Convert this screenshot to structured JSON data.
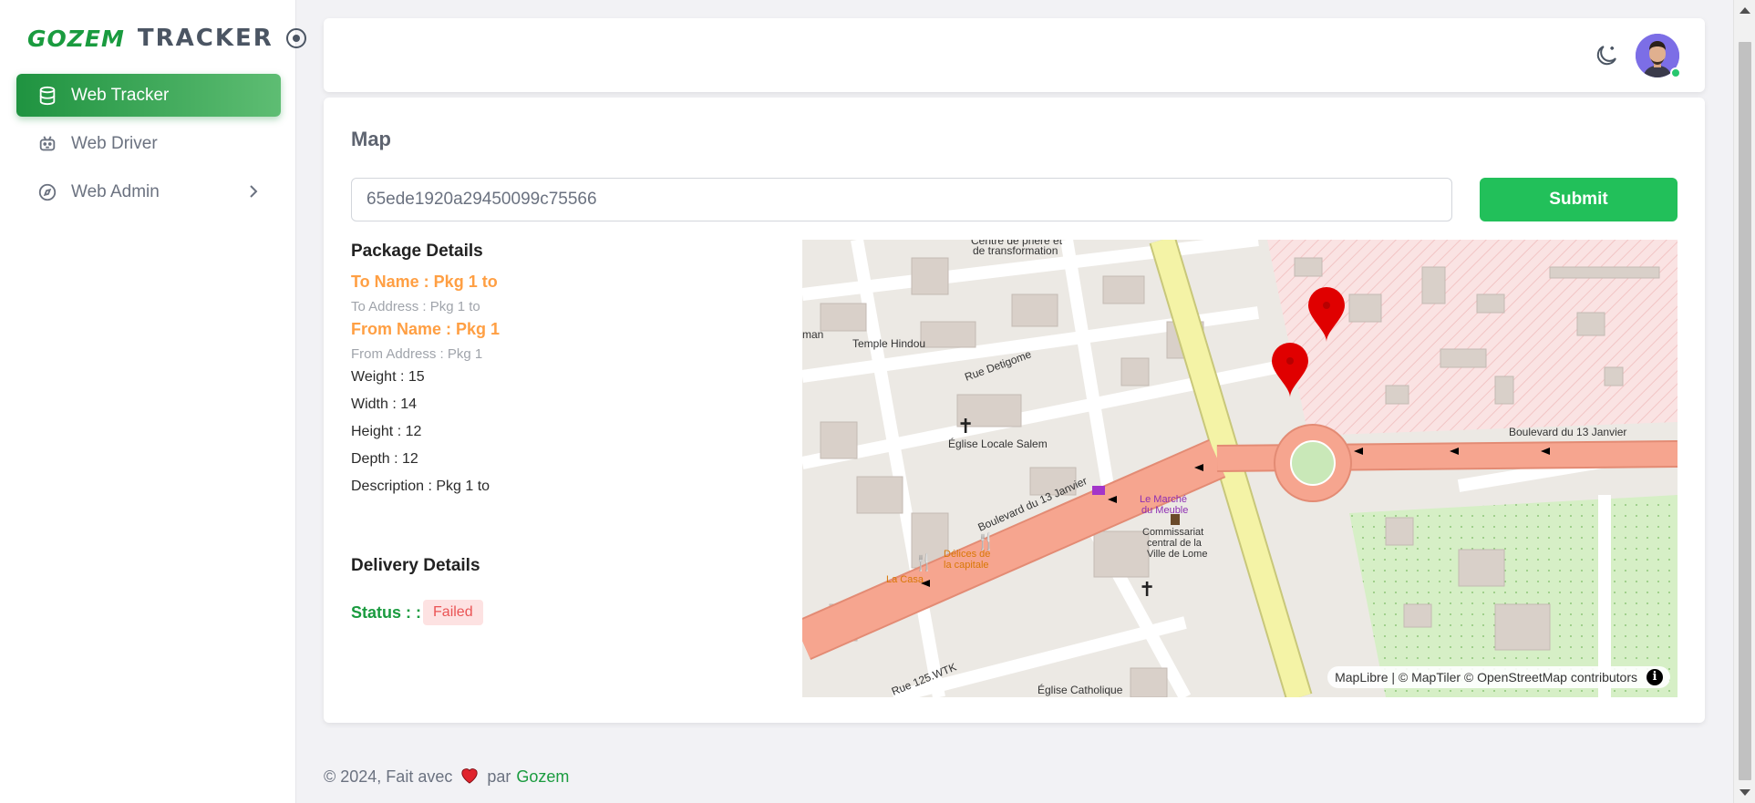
{
  "brand": {
    "name": "GOZEM",
    "product": "TRACKER"
  },
  "sidebar": {
    "items": [
      {
        "label": "Web Tracker",
        "icon": "database-icon",
        "active": true
      },
      {
        "label": "Web Driver",
        "icon": "robot-icon",
        "active": false
      },
      {
        "label": "Web Admin",
        "icon": "compass-icon",
        "active": false,
        "has_submenu": true
      }
    ]
  },
  "header": {
    "theme_icon": "moon-icon",
    "avatar": "user-avatar",
    "status": "online"
  },
  "main": {
    "title": "Map",
    "search": {
      "value": "65ede1920a29450099c75566"
    },
    "submit_label": "Submit"
  },
  "package": {
    "title": "Package Details",
    "to_name": "To Name : Pkg 1 to",
    "to_address": "To Address : Pkg 1 to",
    "from_name": "From Name : Pkg 1",
    "from_address": "From Address : Pkg 1",
    "weight": "Weight : 15",
    "width": "Width : 14",
    "height": "Height : 12",
    "depth": "Depth : 12",
    "description": "Description : Pkg 1 to"
  },
  "delivery": {
    "title": "Delivery Details",
    "status_label": "Status : :",
    "status_value": "Failed"
  },
  "map": {
    "labels": {
      "temple": "Temple Hindou",
      "rue": "Rue Detigome",
      "eglise_salem": "Église Locale Salem",
      "boulevard_left": "Boulevard du 13 Janvier",
      "boulevard_right": "Boulevard du 13 Janvier",
      "marche_1": "Le Marché",
      "marche_2": "du Meuble",
      "commissariat_1": "Commissariat",
      "commissariat_2": "central de la",
      "commissariat_3": "Ville de Lome",
      "delices_1": "Délices de",
      "delices_2": "la capitale",
      "la_casa": "La Casa",
      "centre_1": "Centre de prière et",
      "centre_2": "de transformation",
      "eglise_catholique": "Église Catholique",
      "rue_125": "Rue 125.WTK",
      "man": "man"
    },
    "attribution": "MapLibre | © MapTiler © OpenStreetMap contributors",
    "colors": {
      "marker": "#e00000",
      "highway": "#f6a58f",
      "primary_road": "#f4f3a6",
      "restricted_zone": "#f9e0e0",
      "park": "#d8f0c8"
    }
  },
  "footer": {
    "text": "© 2024, Fait avec",
    "by": "par",
    "link": "Gozem"
  }
}
